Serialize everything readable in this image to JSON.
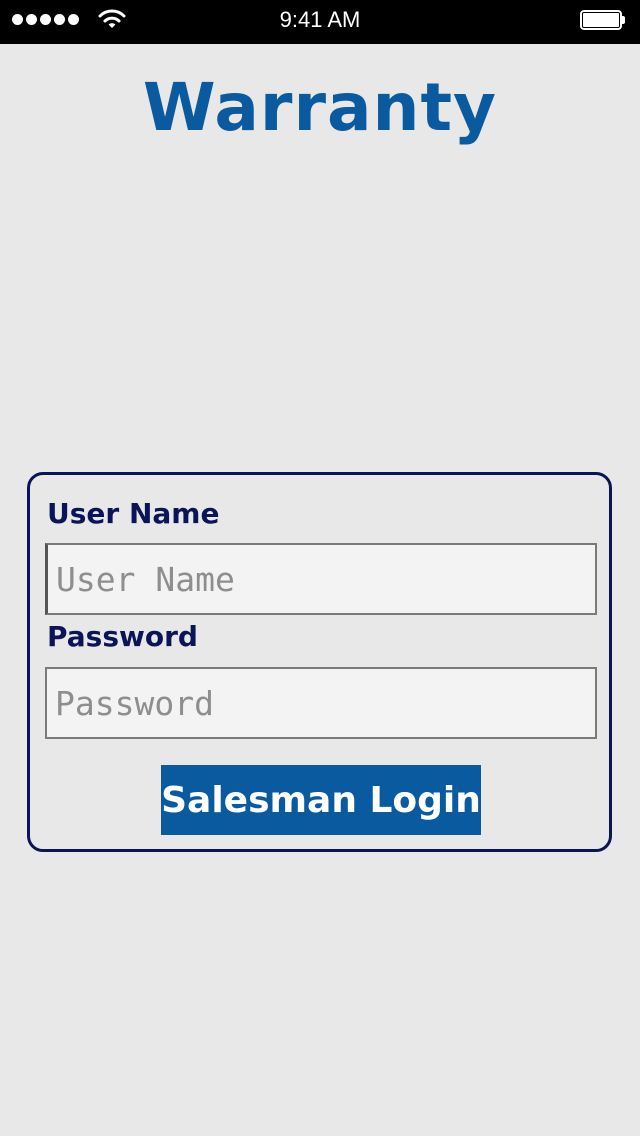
{
  "status_bar": {
    "time": "9:41 AM",
    "signal_icon": "signal-dots-icon",
    "wifi_icon": "wifi-icon",
    "battery_icon": "battery-icon",
    "battery_level": 1.0
  },
  "app": {
    "title": "Warranty",
    "title_color": "#0a5aa0"
  },
  "login": {
    "username_label": "User Name",
    "username_placeholder": "User Name",
    "username_value": "",
    "password_label": "Password",
    "password_placeholder": "Password",
    "password_value": "",
    "submit_label": "Salesman Login",
    "button_color": "#0a5aa0",
    "border_color": "#0b1456"
  }
}
